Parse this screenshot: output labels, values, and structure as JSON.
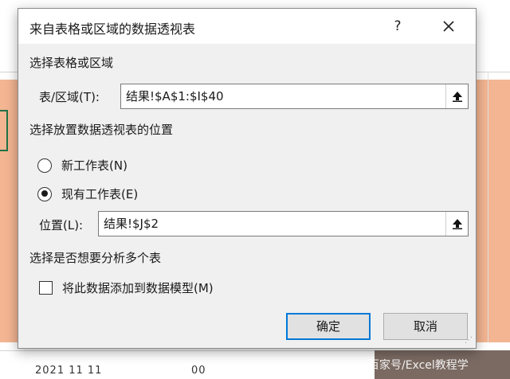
{
  "dialog": {
    "title": "来自表格或区域的数据透视表",
    "help_label": "?",
    "section_source": "选择表格或区域",
    "range_label": "表/区域(T):",
    "range_value": "结果!$A$1:$I$40",
    "section_location": "选择放置数据透视表的位置",
    "option_new_sheet": "新工作表(N)",
    "option_existing_sheet": "现有工作表(E)",
    "selected_option": "existing",
    "location_label": "位置(L):",
    "location_value": "结果!$J$2",
    "section_multi": "选择是否想要分析多个表",
    "add_to_model_label": "将此数据添加到数据模型(M)",
    "add_to_model_checked": false,
    "ok_label": "确定",
    "cancel_label": "取消"
  },
  "background": {
    "bottom_row_text": "2021 11 11",
    "bottom_row_num": "00"
  },
  "watermark": "百家号/Excel教程学"
}
